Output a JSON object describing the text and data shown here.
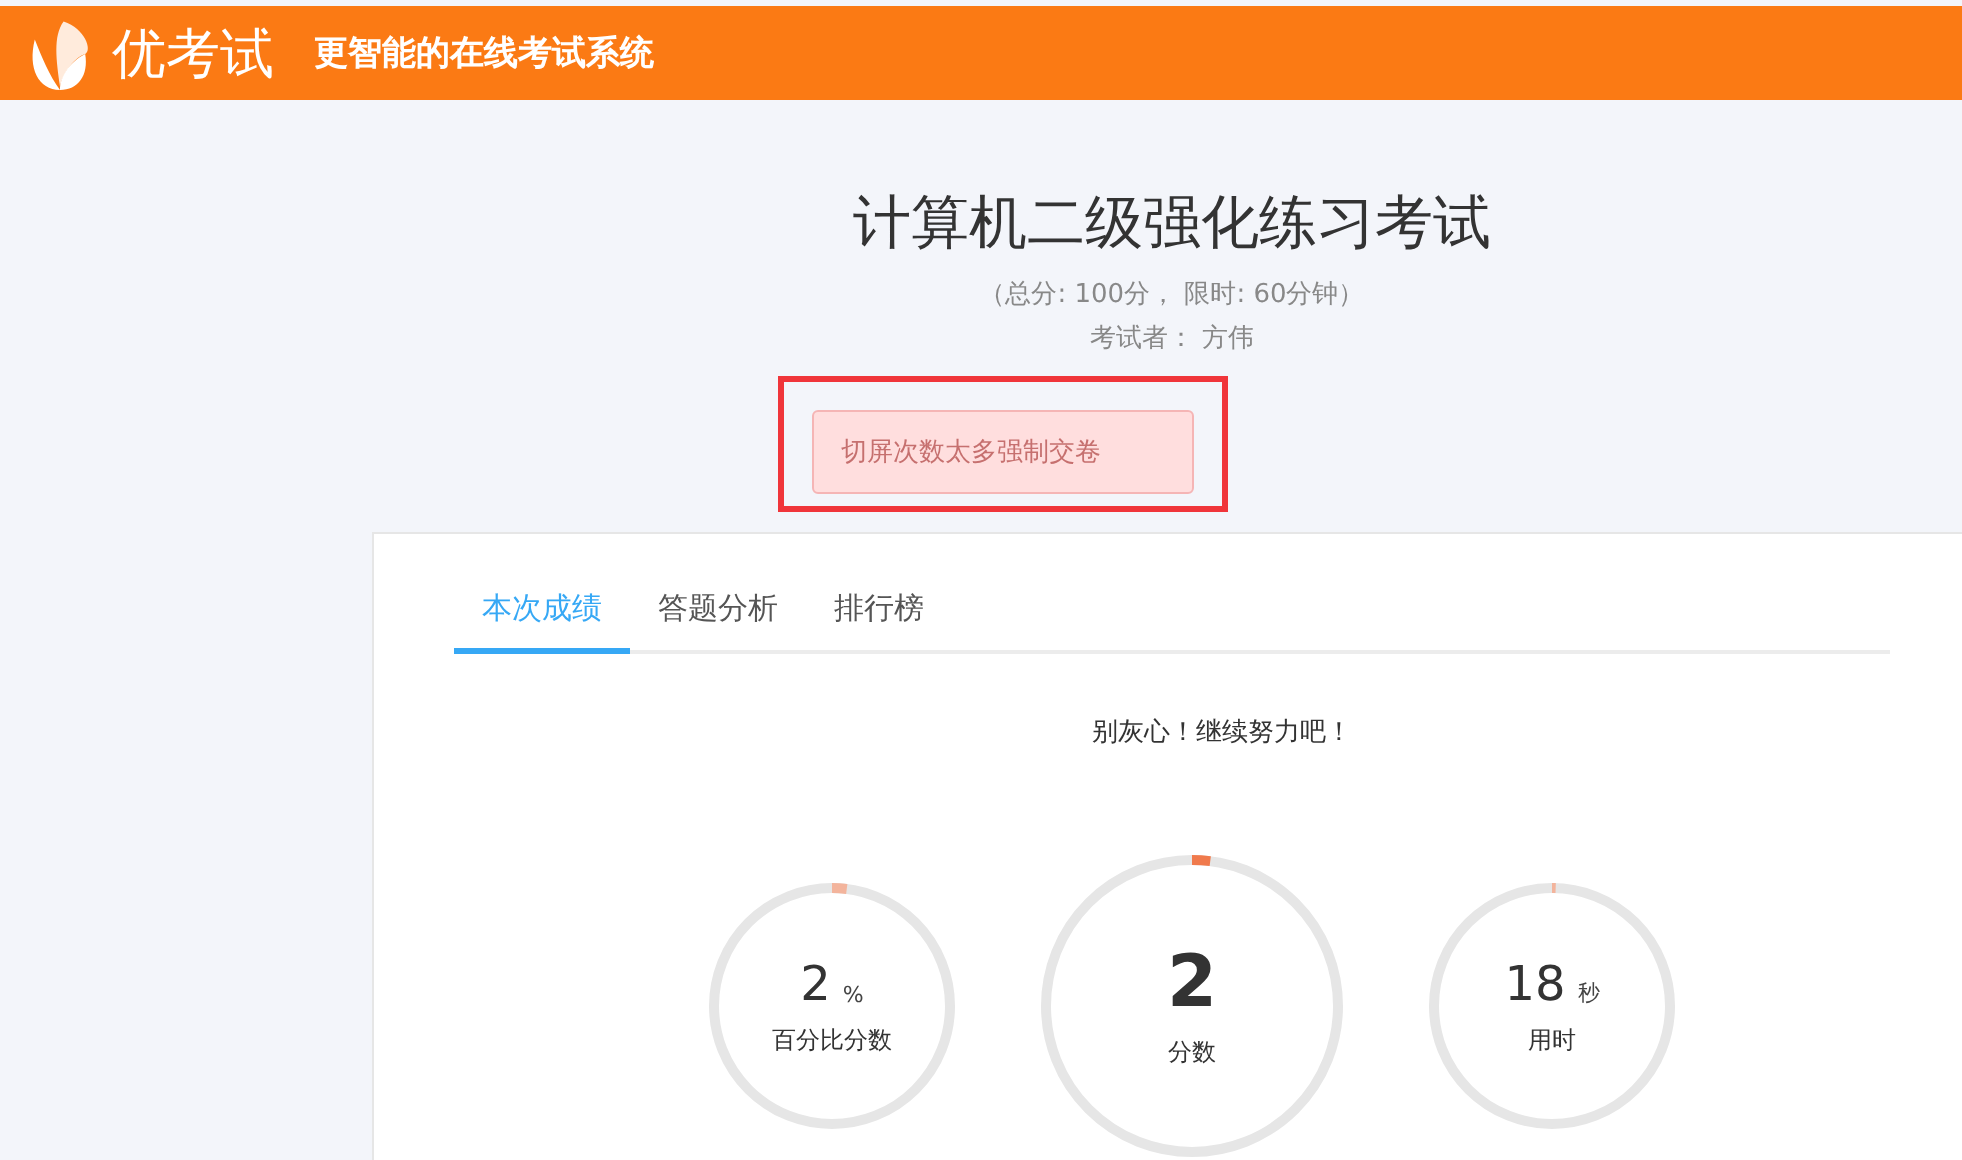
{
  "header": {
    "brand": "优考试",
    "tagline": "更智能的在线考试系统"
  },
  "exam": {
    "title": "计算机二级强化练习考试",
    "meta": "（总分: 100分， 限时: 60分钟）",
    "examinee": "考试者： 方伟"
  },
  "alert": {
    "text": "切屏次数太多强制交卷",
    "highlighted": true
  },
  "tabs": [
    {
      "label": "本次成绩",
      "selected": true
    },
    {
      "label": "答题分析",
      "selected": false
    },
    {
      "label": "排行榜",
      "selected": false
    }
  ],
  "message": "别灰心！继续努力吧！",
  "gauges": [
    {
      "kind": "small",
      "value": "2",
      "unit": "%",
      "label": "百分比分数",
      "level": 0.02
    },
    {
      "kind": "large",
      "value": "2",
      "label": "分数",
      "level": 0.02
    },
    {
      "kind": "small",
      "value": "18",
      "unit": "秒",
      "label": "用时",
      "level": 0.005
    }
  ]
}
